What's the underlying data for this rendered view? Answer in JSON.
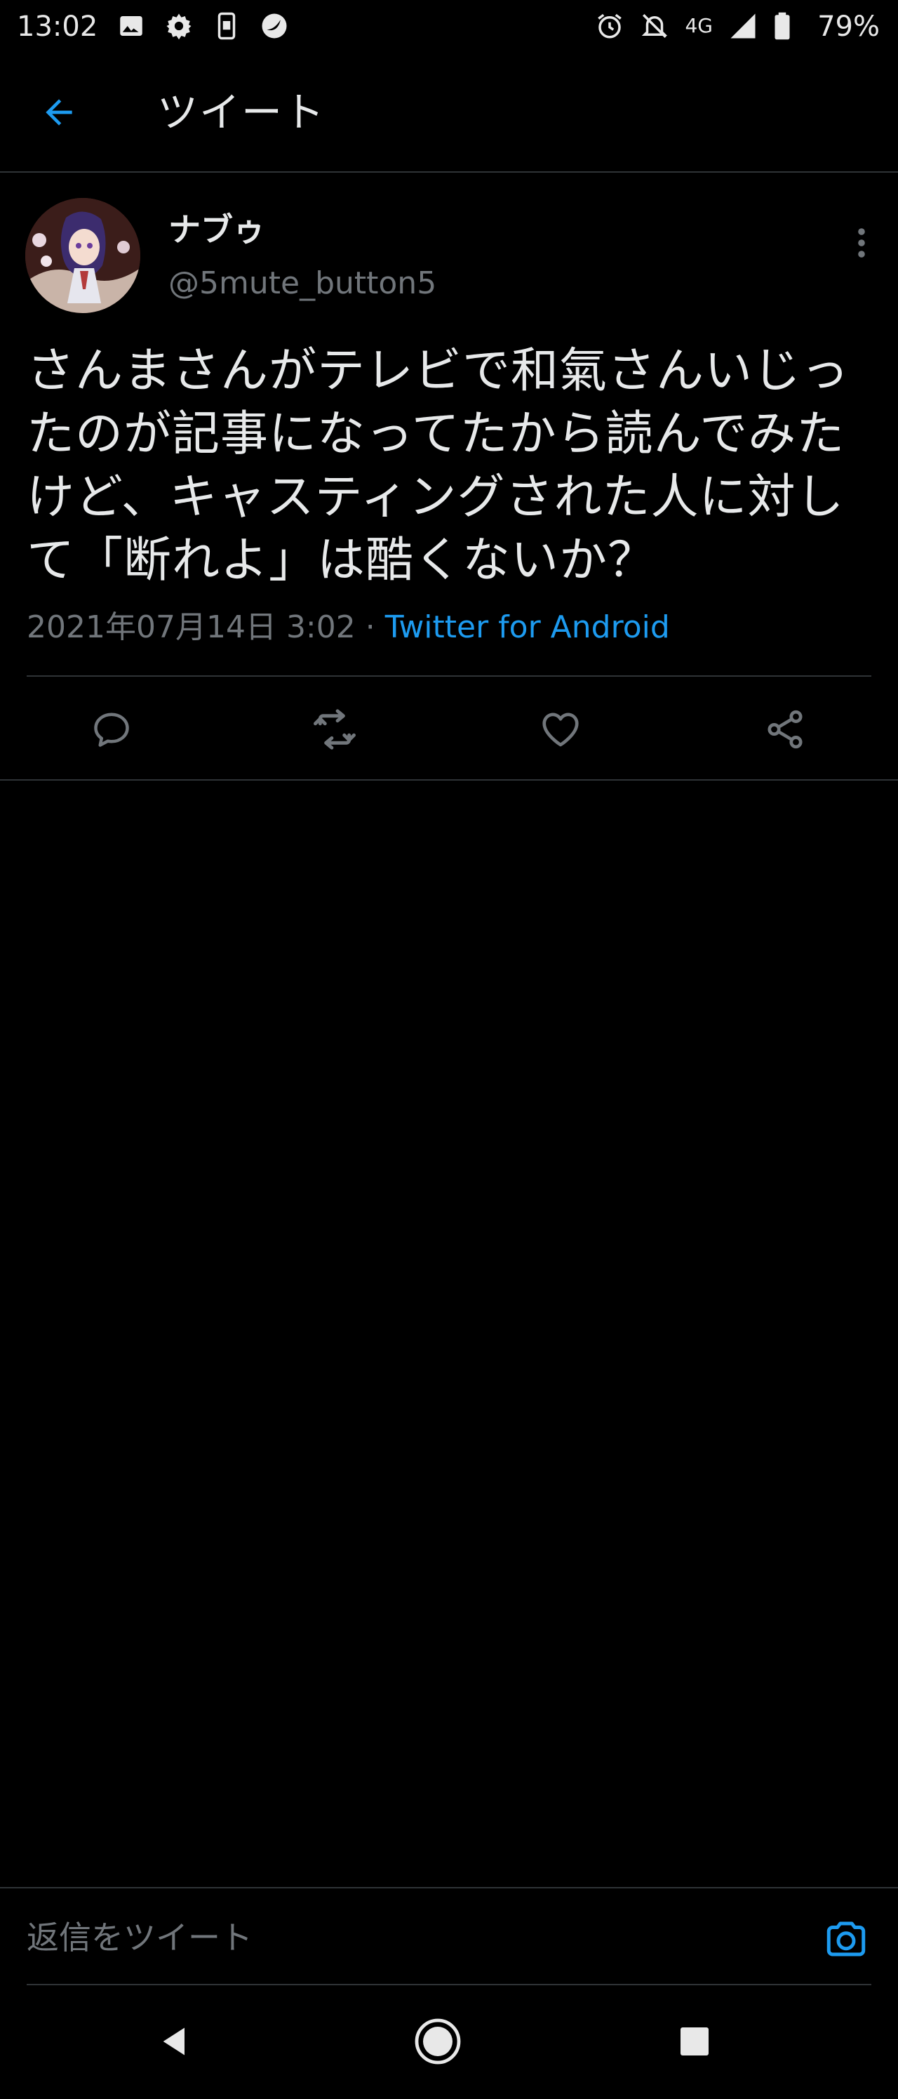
{
  "status_bar": {
    "time": "13:02",
    "network": "4G",
    "battery_percent": "79%",
    "left_icons": [
      "image-icon",
      "gear-icon",
      "sim-icon",
      "app-icon"
    ],
    "right_icons": [
      "alarm-icon",
      "notifications-off-icon",
      "signal-icon",
      "battery-icon"
    ]
  },
  "header": {
    "title": "ツイート",
    "back_icon": "arrow-left-icon"
  },
  "tweet": {
    "author": {
      "display_name": "ナブゥ",
      "handle": "@5mute_button5"
    },
    "text": "さんまさんがテレビで和氣さんいじったのが記事になってたから読んでみたけど、キャスティングされた人に対して「断れよ」は酷くないか？",
    "timestamp": "2021年07月14日 3:02",
    "separator": " · ",
    "client": "Twitter for Android",
    "actions": [
      {
        "name": "reply-button",
        "icon": "comment-icon"
      },
      {
        "name": "retweet-button",
        "icon": "retweet-icon"
      },
      {
        "name": "like-button",
        "icon": "heart-icon"
      },
      {
        "name": "share-button",
        "icon": "share-icon"
      }
    ]
  },
  "reply_bar": {
    "placeholder": "返信をツイート",
    "camera_icon": "camera-icon"
  },
  "nav_bar": {
    "buttons": [
      "back-triangle-icon",
      "home-circle-icon",
      "recents-square-icon"
    ]
  },
  "colors": {
    "background": "#000000",
    "text_primary": "#e7e9ea",
    "text_secondary": "#71767b",
    "accent": "#1d9bf0",
    "divider": "#2f3336"
  }
}
